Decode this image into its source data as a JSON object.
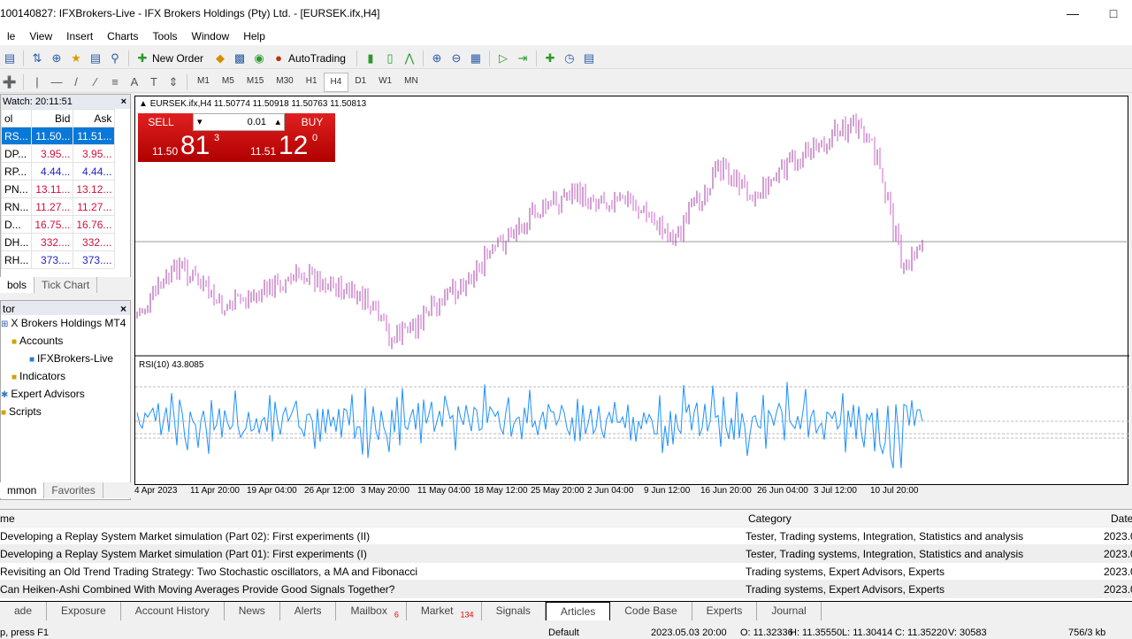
{
  "window": {
    "title": "100140827: IFXBrokers-Live - IFX Brokers Holdings (Pty) Ltd. - [EURSEK.ifx,H4]"
  },
  "menu": [
    "le",
    "View",
    "Insert",
    "Charts",
    "Tools",
    "Window",
    "Help"
  ],
  "toolbar": {
    "new_order": "New Order",
    "autotrading": "AutoTrading",
    "timeframes": [
      "M1",
      "M5",
      "M15",
      "M30",
      "H1",
      "H4",
      "D1",
      "W1",
      "MN"
    ],
    "active_timeframe": "H4"
  },
  "market_watch": {
    "title": "Watch: 20:11:51",
    "columns": [
      "ol",
      "Bid",
      "Ask"
    ],
    "rows": [
      {
        "s": "RS...",
        "bid": "11.50...",
        "ask": "11.51...",
        "color": "#ffffff",
        "sel": true
      },
      {
        "s": "DP...",
        "bid": "3.95...",
        "ask": "3.95...",
        "color": "#d0103a"
      },
      {
        "s": "RP...",
        "bid": "4.44...",
        "ask": "4.44...",
        "color": "#2222cc"
      },
      {
        "s": "PN...",
        "bid": "13.11...",
        "ask": "13.12...",
        "color": "#d0103a"
      },
      {
        "s": "RN...",
        "bid": "11.27...",
        "ask": "11.27...",
        "color": "#d0103a"
      },
      {
        "s": "D...",
        "bid": "16.75...",
        "ask": "16.76...",
        "color": "#d0103a"
      },
      {
        "s": "DH...",
        "bid": "332....",
        "ask": "332....",
        "color": "#d0103a"
      },
      {
        "s": "RH...",
        "bid": "373....",
        "ask": "373....",
        "color": "#2222cc"
      }
    ],
    "tabs": [
      "bols",
      "Tick Chart"
    ]
  },
  "navigator": {
    "title": "tor",
    "items": [
      "X Brokers Holdings MT4",
      "Accounts",
      "IFXBrokers-Live",
      "Indicators",
      "Expert Advisors",
      "Scripts"
    ],
    "tabs": [
      "mmon",
      "Favorites"
    ]
  },
  "chart": {
    "header": "EURSEK.ifx,H4  11.50774 11.50918 11.50763 11.50813",
    "sell": "SELL",
    "buy": "BUY",
    "lot": "0.01",
    "sell_price": {
      "pre": "11.50",
      "big": "81",
      "sup": "3"
    },
    "buy_price": {
      "pre": "11.51",
      "big": "12",
      "sup": "0"
    },
    "rsi_label": "RSI(10) 43.8085",
    "time_labels": [
      "4 Apr 2023",
      "11 Apr 20:00",
      "19 Apr 04:00",
      "26 Apr 12:00",
      "3 May 20:00",
      "11 May 04:00",
      "18 May 12:00",
      "25 May 20:00",
      "2 Jun 04:00",
      "9 Jun 12:00",
      "16 Jun 20:00",
      "26 Jun 04:00",
      "3 Jul 12:00",
      "10 Jul 20:00"
    ],
    "bull_color": "#a040a0",
    "bear_color": "#cc66cc",
    "rsi_color": "#1e90ff"
  },
  "terminal": {
    "columns": [
      "me",
      "Category",
      "Date"
    ],
    "rows": [
      {
        "name": "Developing a Replay System  Market simulation (Part 02): First experiments (II)",
        "cat": "Tester, Trading systems, Integration, Statistics and analysis",
        "date": "2023.0"
      },
      {
        "name": "Developing a Replay System  Market simulation (Part 01): First experiments (I)",
        "cat": "Tester, Trading systems, Integration, Statistics and analysis",
        "date": "2023.0"
      },
      {
        "name": "Revisiting an Old Trend Trading Strategy: Two Stochastic oscillators, a MA and Fibonacci",
        "cat": "Trading systems, Expert Advisors, Experts",
        "date": "2023.0"
      },
      {
        "name": "Can Heiken-Ashi Combined With Moving Averages Provide Good Signals Together?",
        "cat": "Trading systems, Expert Advisors, Experts",
        "date": "2023.0"
      }
    ],
    "tabs": [
      "ade",
      "Exposure",
      "Account History",
      "News",
      "Alerts",
      "Mailbox",
      "Market",
      "Signals",
      "Articles",
      "Code Base",
      "Experts",
      "Journal"
    ],
    "mailbox_badge": "6",
    "market_badge": "134",
    "active_tab": "Articles"
  },
  "status": {
    "help": "p, press F1",
    "profile": "Default",
    "time": "2023.05.03 20:00",
    "o": "O: 11.32336",
    "h": "H: 11.35550",
    "l": "L: 11.30414",
    "c": "C: 11.35220",
    "v": "V: 30583",
    "traffic": "756/3 kb"
  }
}
